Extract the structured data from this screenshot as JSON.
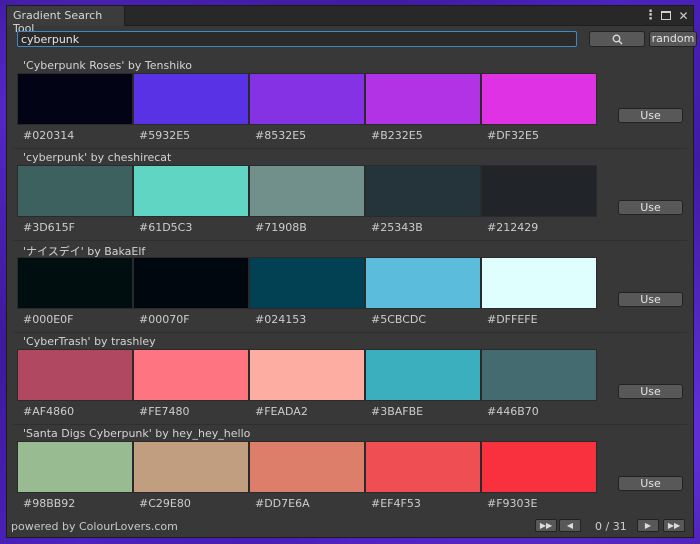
{
  "window": {
    "tab_title": "Gradient Search Tool"
  },
  "search": {
    "value": "cyberpunk",
    "random_label": "random"
  },
  "palettes": [
    {
      "title": "'Cyberpunk Roses' by Tenshiko",
      "colors": [
        {
          "hex": "#020314",
          "label": "#020314"
        },
        {
          "hex": "#5932E5",
          "label": "#5932E5"
        },
        {
          "hex": "#8532E5",
          "label": "#8532E5"
        },
        {
          "hex": "#B232E5",
          "label": "#B232E5"
        },
        {
          "hex": "#DF32E5",
          "label": "#DF32E5"
        }
      ],
      "use_label": "Use"
    },
    {
      "title": "'cyberpunk' by cheshirecat",
      "colors": [
        {
          "hex": "#3D615F",
          "label": "#3D615F"
        },
        {
          "hex": "#61D5C3",
          "label": "#61D5C3"
        },
        {
          "hex": "#71908B",
          "label": "#71908B"
        },
        {
          "hex": "#25343B",
          "label": "#25343B"
        },
        {
          "hex": "#212429",
          "label": "#212429"
        }
      ],
      "use_label": "Use"
    },
    {
      "title": "'ナイスデイ' by BakaElf",
      "colors": [
        {
          "hex": "#000E0F",
          "label": "#000E0F"
        },
        {
          "hex": "#00070F",
          "label": "#00070F"
        },
        {
          "hex": "#024153",
          "label": "#024153"
        },
        {
          "hex": "#5CBCDC",
          "label": "#5CBCDC"
        },
        {
          "hex": "#DFFEFE",
          "label": "#DFFEFE"
        }
      ],
      "use_label": "Use"
    },
    {
      "title": "'CyberTrash' by trashley",
      "colors": [
        {
          "hex": "#AF4860",
          "label": "#AF4860"
        },
        {
          "hex": "#FE7480",
          "label": "#FE7480"
        },
        {
          "hex": "#FEADA2",
          "label": "#FEADA2"
        },
        {
          "hex": "#3BAFBE",
          "label": "#3BAFBE"
        },
        {
          "hex": "#446B70",
          "label": "#446B70"
        }
      ],
      "use_label": "Use"
    },
    {
      "title": "'Santa Digs Cyberpunk' by hey_hey_hello",
      "colors": [
        {
          "hex": "#98BB92",
          "label": "#98BB92"
        },
        {
          "hex": "#C29E80",
          "label": "#C29E80"
        },
        {
          "hex": "#DD7E6A",
          "label": "#DD7E6A"
        },
        {
          "hex": "#EF4F53",
          "label": "#EF4F53"
        },
        {
          "hex": "#F9303E",
          "label": "#F9303E"
        }
      ],
      "use_label": "Use"
    }
  ],
  "footer": {
    "powered_by": "powered by ColourLovers.com",
    "page_label": "0 / 31",
    "first_icon": "first-page-icon",
    "prev_icon": "prev-page-icon",
    "next_icon": "next-page-icon",
    "last_icon": "last-page-icon"
  }
}
